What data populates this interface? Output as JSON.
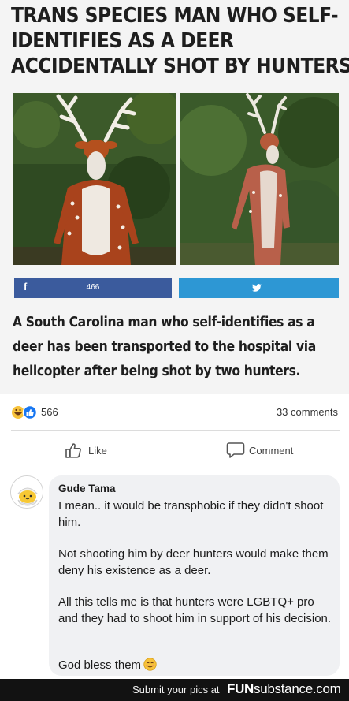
{
  "article": {
    "headline_lines": [
      "TRANS SPECIES MAN WHO SELF-",
      "IDENTIFIES AS A DEER",
      "ACCIDENTALLY SHOT BY HUNTERS"
    ],
    "share": {
      "facebook_glyph": "f",
      "facebook_count": "466"
    },
    "summary_lines": [
      "A South Carolina man who self-identifies as a",
      "deer has been transported to the hospital via",
      "helicopter after being shot by two hunters."
    ]
  },
  "post_stats": {
    "reaction_count": "566",
    "comments_label": "33 comments"
  },
  "actions": {
    "like_label": "Like",
    "comment_label": "Comment"
  },
  "comment": {
    "author": "Gude Tama",
    "paragraphs": [
      "I mean.. it would be transphobic if they didn't shoot him.",
      "Not shooting him by deer hunters would make them deny his existence as a deer.",
      "All this tells me is that hunters were LGBTQ+ pro and they had to shoot him in support of his decision.",
      "God bless them"
    ]
  },
  "watermark": {
    "text": "Submit your pics at",
    "logo_fun": "FUN",
    "logo_substance": "substance.com"
  },
  "colors": {
    "facebook_blue": "#3b5b9d",
    "twitter_blue": "#2d97d4",
    "bubble_bg": "#f0f1f3"
  }
}
